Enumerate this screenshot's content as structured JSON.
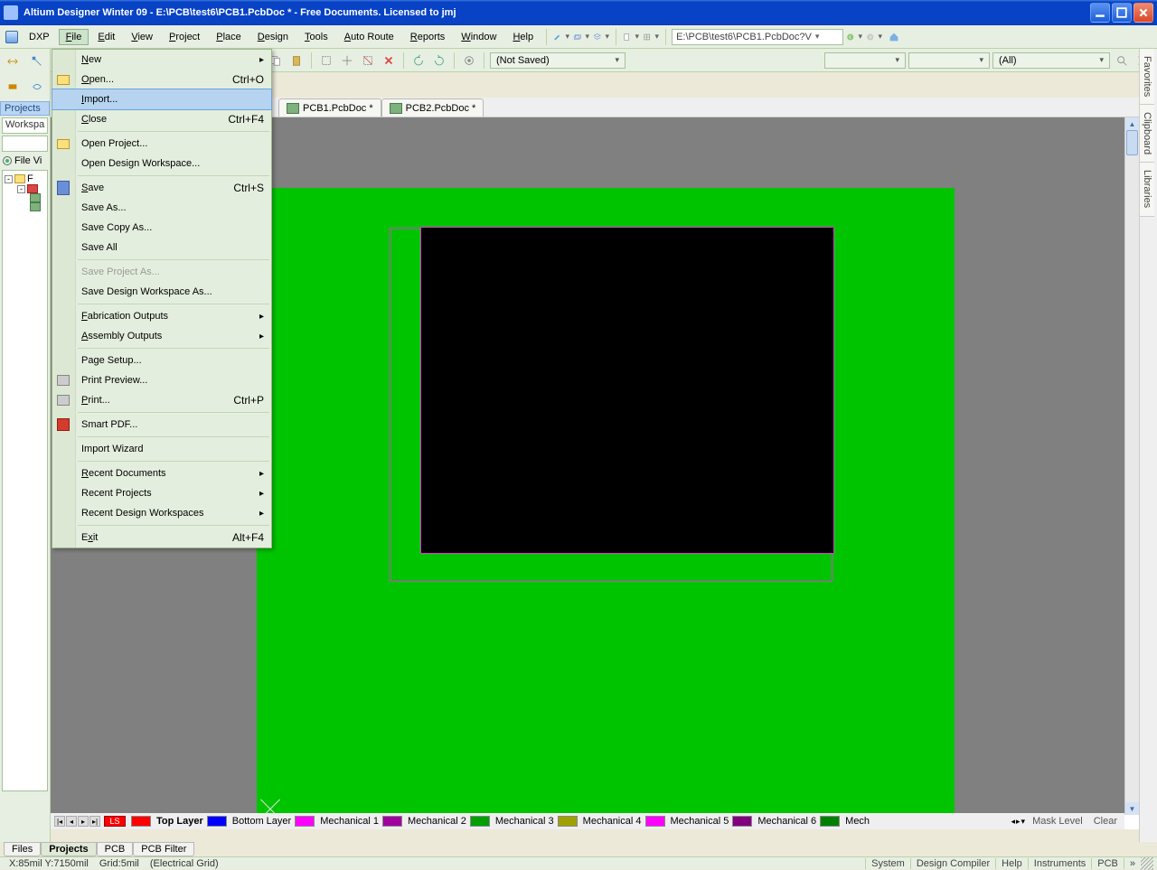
{
  "title": "Altium Designer Winter 09 - E:\\PCB\\test6\\PCB1.PcbDoc * - Free Documents. Licensed to jmj",
  "menubar": {
    "dxp": "DXP",
    "items": [
      "File",
      "Edit",
      "View",
      "Project",
      "Place",
      "Design",
      "Tools",
      "Auto Route",
      "Reports",
      "Window",
      "Help"
    ],
    "address": "E:\\PCB\\test6\\PCB1.PcbDoc?V"
  },
  "toolbar2": {
    "notsaved": "(Not Saved)",
    "all": "(All)"
  },
  "leftpanel": {
    "projects_hdr": "Projects",
    "workspace": "Workspa",
    "fileview": "File Vi",
    "tree_root": "F"
  },
  "righttabs": [
    "Favorites",
    "Clipboard",
    "Libraries"
  ],
  "doctabs": [
    {
      "label": "PCB1.PcbDoc *"
    },
    {
      "label": "PCB2.PcbDoc *"
    }
  ],
  "layertabs": {
    "ls": "LS",
    "items": [
      {
        "color": "#ff0000",
        "label": "Top Layer",
        "bold": true
      },
      {
        "color": "#0000ff",
        "label": "Bottom Layer"
      },
      {
        "color": "#ff00ff",
        "label": "Mechanical 1"
      },
      {
        "color": "#a000a0",
        "label": "Mechanical 2"
      },
      {
        "color": "#00a000",
        "label": "Mechanical 3"
      },
      {
        "color": "#a0a000",
        "label": "Mechanical 4"
      },
      {
        "color": "#ff00ff",
        "label": "Mechanical 5"
      },
      {
        "color": "#800080",
        "label": "Mechanical 6"
      },
      {
        "color": "#008000",
        "label": "Mech"
      }
    ],
    "mask": "Mask Level",
    "clear": "Clear"
  },
  "bottomtabs": [
    "Files",
    "Projects",
    "PCB",
    "PCB Filter"
  ],
  "statusbar": {
    "coords": "X:85mil Y:7150mil",
    "grid": "Grid:5mil",
    "egrid": "(Electrical Grid)",
    "right": [
      "System",
      "Design Compiler",
      "Help",
      "Instruments",
      "PCB"
    ]
  },
  "file_menu": {
    "new": "New",
    "open": "Open...",
    "open_sc": "Ctrl+O",
    "import": "Import...",
    "close": "Close",
    "close_sc": "Ctrl+F4",
    "open_project": "Open Project...",
    "open_ws": "Open Design Workspace...",
    "save": "Save",
    "save_sc": "Ctrl+S",
    "save_as": "Save As...",
    "save_copy": "Save Copy As...",
    "save_all": "Save All",
    "save_proj_as": "Save Project As...",
    "save_ws_as": "Save Design Workspace As...",
    "fab": "Fabrication Outputs",
    "asm": "Assembly Outputs",
    "page_setup": "Page Setup...",
    "print_prev": "Print Preview...",
    "print": "Print...",
    "print_sc": "Ctrl+P",
    "smart_pdf": "Smart PDF...",
    "import_wiz": "Import Wizard",
    "recent_docs": "Recent Documents",
    "recent_projs": "Recent Projects",
    "recent_ws": "Recent Design Workspaces",
    "exit": "Exit",
    "exit_sc": "Alt+F4"
  }
}
